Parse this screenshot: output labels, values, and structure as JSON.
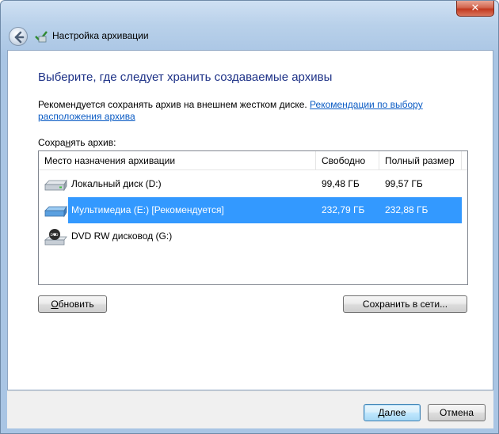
{
  "window": {
    "title": "Настройка архивации",
    "close_label": "✕"
  },
  "content": {
    "heading": "Выберите, где следует хранить создаваемые архивы",
    "recommendation_text": "Рекомендуется сохранять архив на внешнем жестком диске. ",
    "recommendation_link": "Рекомендации по выбору расположения архива",
    "save_label_pre": "Сохра",
    "save_label_accel": "н",
    "save_label_post": "ять архив:"
  },
  "list": {
    "columns": [
      "Место назначения архивации",
      "Свободно",
      "Полный размер"
    ],
    "rows": [
      {
        "name": "Локальный диск (D:)",
        "free": "99,48 ГБ",
        "total": "99,57 ГБ",
        "icon": "hard-drive-icon",
        "selected": false
      },
      {
        "name": "Мультимедиа (E:) [Рекомендуется]",
        "free": "232,79 ГБ",
        "total": "232,88 ГБ",
        "icon": "external-drive-icon",
        "selected": true
      },
      {
        "name": "DVD RW дисковод (G:)",
        "free": "",
        "total": "",
        "icon": "dvd-drive-icon",
        "selected": false
      }
    ]
  },
  "buttons": {
    "refresh_accel": "О",
    "refresh_rest": "бновить",
    "save_network": "Сохранить в сети...",
    "next_accel": "Д",
    "next_rest": "алее",
    "cancel": "Отмена"
  },
  "colors": {
    "heading": "#1e3287",
    "link": "#0a5bc4",
    "selection": "#3399ff"
  }
}
